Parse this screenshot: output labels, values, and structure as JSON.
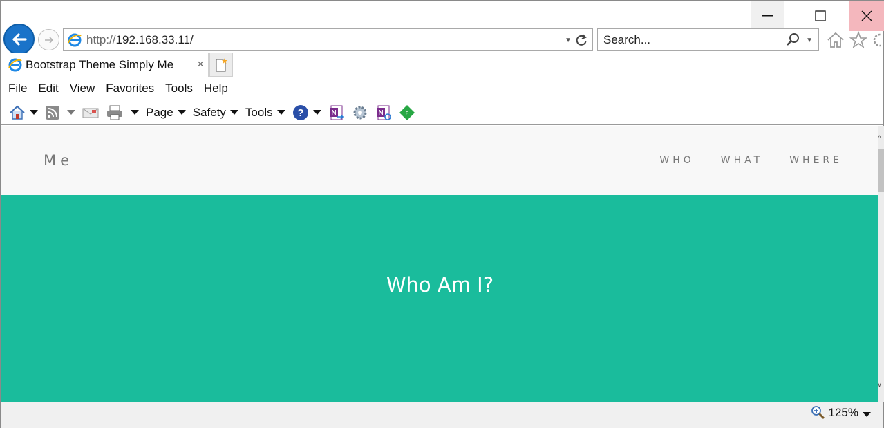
{
  "window": {
    "minimize_glyph": "—",
    "maximize_glyph": "☐",
    "close_glyph": "✕"
  },
  "address_bar": {
    "url_prefix": "http://",
    "url_host": "192.168.33.11/"
  },
  "search": {
    "placeholder": "Search..."
  },
  "tab": {
    "title": "Bootstrap Theme Simply Me",
    "close_glyph": "×"
  },
  "menu": {
    "items": [
      "File",
      "Edit",
      "View",
      "Favorites",
      "Tools",
      "Help"
    ]
  },
  "command_bar": {
    "page_label": "Page",
    "safety_label": "Safety",
    "tools_label": "Tools"
  },
  "site": {
    "brand": "Me",
    "nav": [
      "WHO",
      "WHAT",
      "WHERE"
    ],
    "hero_heading": "Who Am I?",
    "hero_color": "#1abc9c"
  },
  "status": {
    "zoom": "125%"
  },
  "icons": {
    "back": "back-arrow-icon",
    "forward": "forward-arrow-icon",
    "refresh": "refresh-icon",
    "search": "search-icon",
    "home": "home-icon",
    "favorites": "star-icon",
    "settings": "gear-icon"
  }
}
